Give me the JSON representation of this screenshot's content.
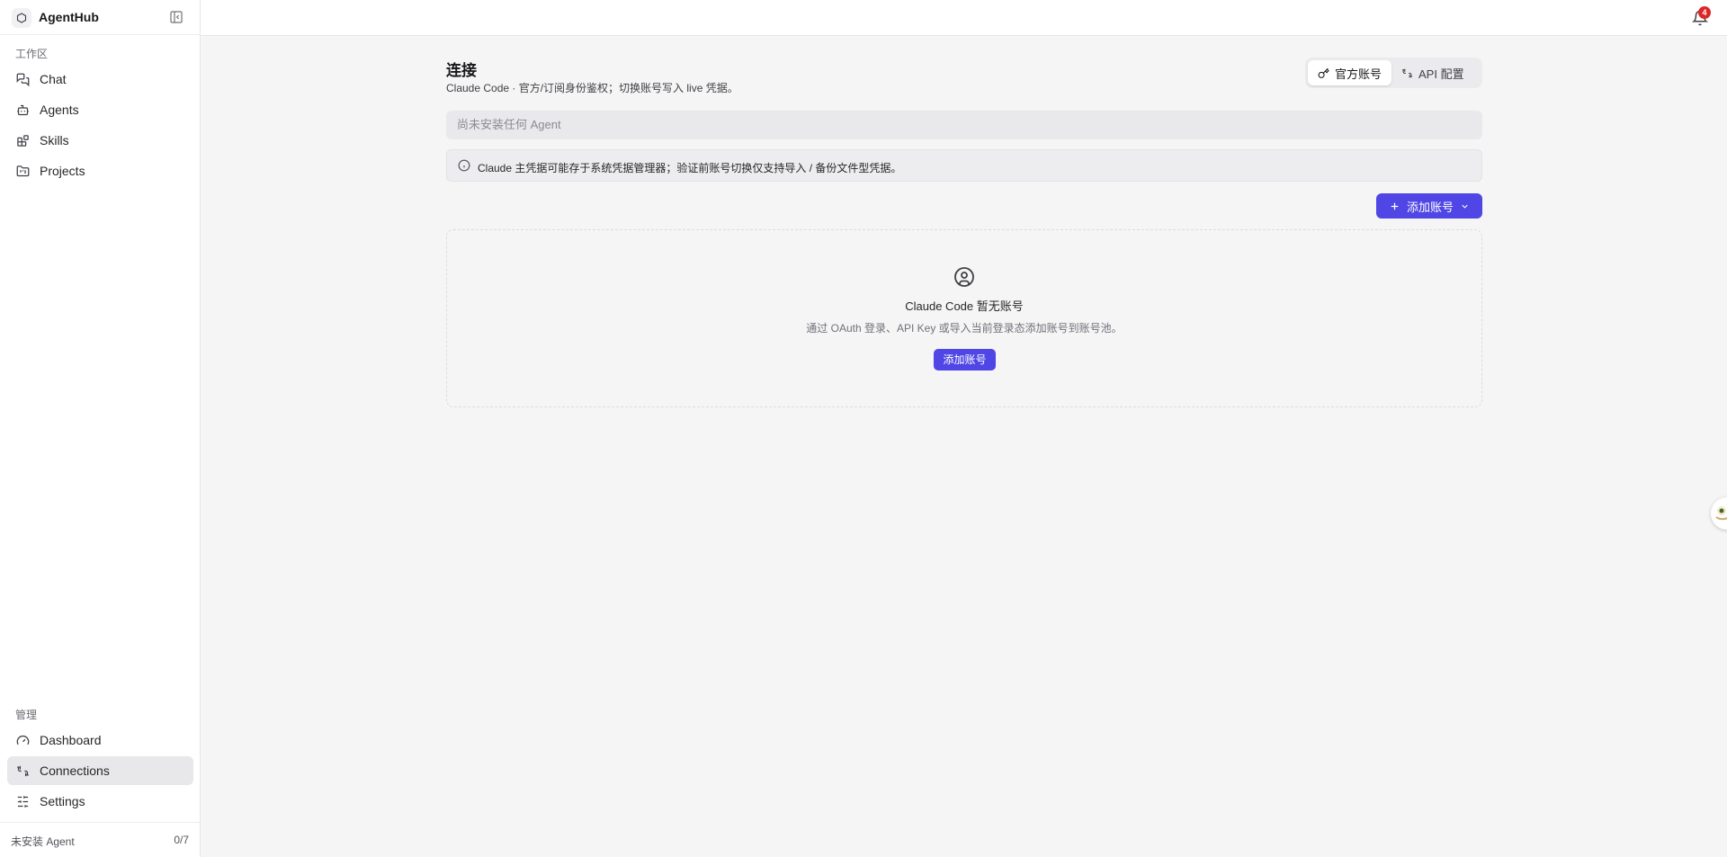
{
  "app": {
    "name": "AgentHub",
    "logo_icon": "hexagon-icon"
  },
  "sidebar": {
    "workspace_label": "工作区",
    "workspace_items": [
      {
        "label": "Chat",
        "icon": "chat-icon"
      },
      {
        "label": "Agents",
        "icon": "bot-icon"
      },
      {
        "label": "Skills",
        "icon": "blocks-icon"
      },
      {
        "label": "Projects",
        "icon": "folder-kanban-icon"
      }
    ],
    "manage_label": "管理",
    "manage_items": [
      {
        "label": "Dashboard",
        "icon": "gauge-icon"
      },
      {
        "label": "Connections",
        "icon": "connections-icon",
        "active": true
      },
      {
        "label": "Settings",
        "icon": "sliders-icon"
      }
    ],
    "footer": {
      "status": "未安装 Agent",
      "count": "0/7"
    }
  },
  "topbar": {
    "notification_count": "4"
  },
  "main": {
    "title": "连接",
    "subtitle": "Claude Code · 官方/订阅身份鉴权；切换账号写入 live 凭据。",
    "toggle": {
      "official_label": "官方账号",
      "api_label": "API 配置",
      "active": "official"
    },
    "agent_select": {
      "placeholder": "尚未安装任何 Agent"
    },
    "info_banner": "Claude 主凭据可能存于系统凭据管理器；验证前账号切换仅支持导入 / 备份文件型凭据。",
    "add_account_label": "添加账号",
    "empty_state": {
      "title": "Claude Code 暂无账号",
      "description": "通过 OAuth 登录、API Key 或导入当前登录态添加账号到账号池。",
      "button_label": "添加账号"
    }
  },
  "colors": {
    "accent": "#4f46e5",
    "badge": "#dc2626",
    "active_nav": "#e8e8ea"
  }
}
